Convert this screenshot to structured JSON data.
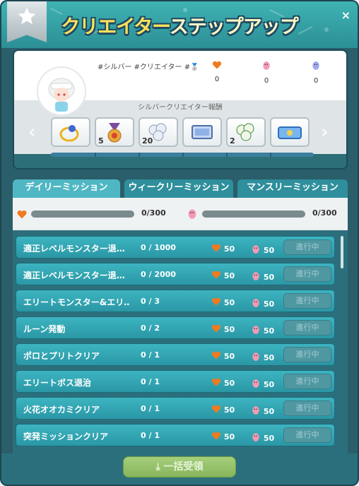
{
  "window": {
    "title_part1": "クリエイター",
    "title_part2": "ステップアップ",
    "close_label": "×"
  },
  "profile": {
    "tags": "#シルバー #クリエイター #🥈",
    "stats": [
      {
        "icon": "orange-heart-icon",
        "value": "0",
        "color": "#f07a1f"
      },
      {
        "icon": "pink-bean-icon",
        "value": "0",
        "color": "#f49ab5"
      },
      {
        "icon": "purple-bean-icon",
        "value": "0",
        "color": "#9ea9f0"
      }
    ]
  },
  "rewards": {
    "title": "シルバークリエイター報酬",
    "items": [
      {
        "icon": "ring-icon",
        "count": ""
      },
      {
        "icon": "medal-icon",
        "count": "5"
      },
      {
        "icon": "cloud-cluster-icon",
        "count": "20"
      },
      {
        "icon": "screen-icon",
        "count": ""
      },
      {
        "icon": "green-cluster-icon",
        "count": "2"
      },
      {
        "icon": "ticket-icon",
        "count": ""
      }
    ]
  },
  "tabs": [
    "デイリーミッション",
    "ウィークリーミッション",
    "マンスリーミッション"
  ],
  "overall_progress": {
    "heart": "0/300",
    "bean": "0/300"
  },
  "missions": [
    {
      "name": "適正レベルモンスター退…",
      "progress": "0 / 1000",
      "heart": "50",
      "bean": "50",
      "button": "進行中"
    },
    {
      "name": "適正レベルモンスター退…",
      "progress": "0 / 2000",
      "heart": "50",
      "bean": "50",
      "button": "進行中"
    },
    {
      "name": "エリートモンスター&エリ…",
      "progress": "0 / 3",
      "heart": "50",
      "bean": "50",
      "button": "進行中"
    },
    {
      "name": "ルーン発動",
      "progress": "0 / 2",
      "heart": "50",
      "bean": "50",
      "button": "進行中"
    },
    {
      "name": "ポロとプリトクリア",
      "progress": "0 / 1",
      "heart": "50",
      "bean": "50",
      "button": "進行中"
    },
    {
      "name": "エリートボス退治",
      "progress": "0 / 1",
      "heart": "50",
      "bean": "50",
      "button": "進行中"
    },
    {
      "name": "火花オオカミクリア",
      "progress": "0 / 1",
      "heart": "50",
      "bean": "50",
      "button": "進行中"
    },
    {
      "name": "突発ミッションクリア",
      "progress": "0 / 1",
      "heart": "50",
      "bean": "50",
      "button": "進行中"
    }
  ],
  "footer": {
    "claim_all_label": "一括受領"
  }
}
